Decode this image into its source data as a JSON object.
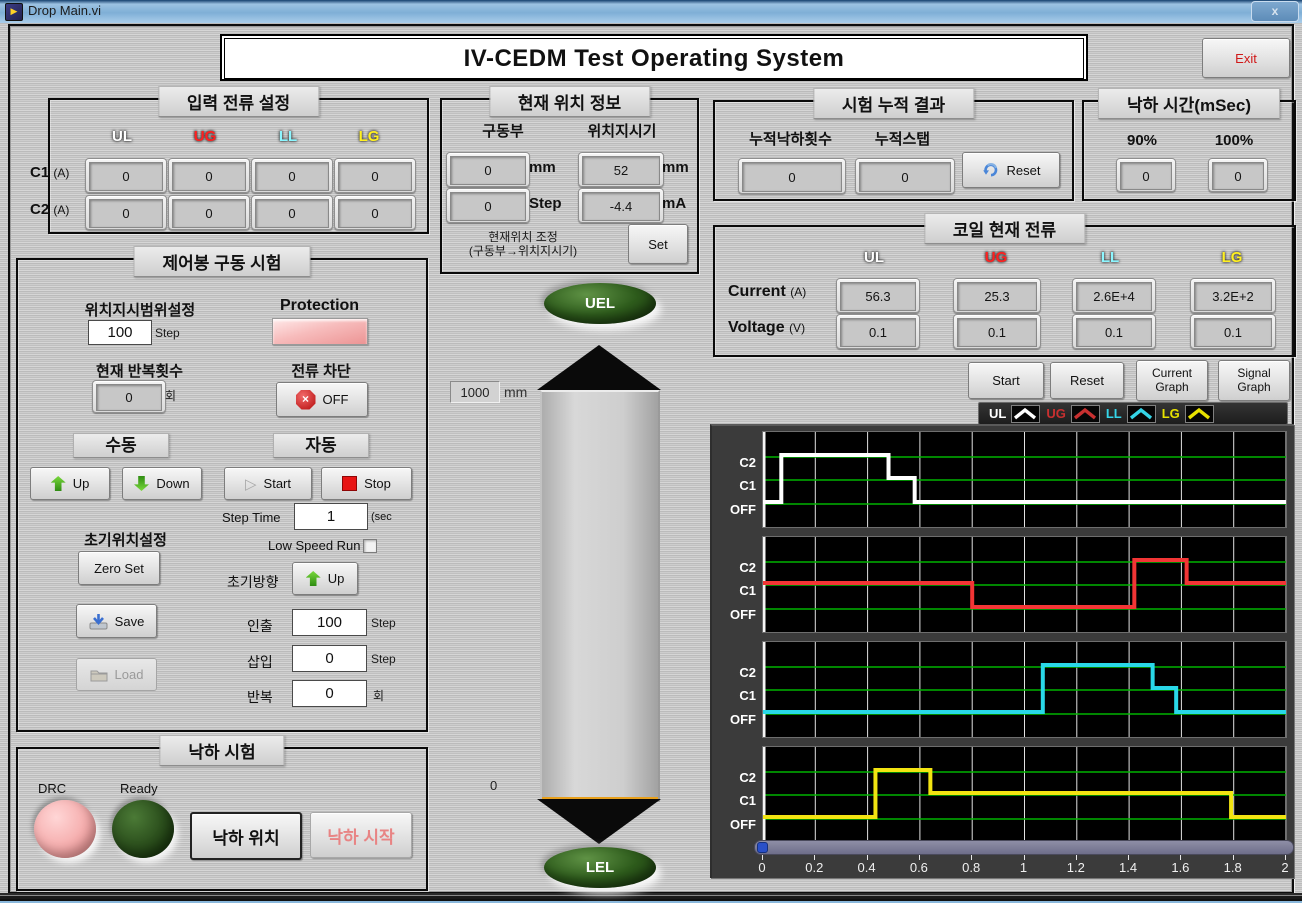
{
  "window": {
    "title": "Drop Main.vi",
    "close_label": "x"
  },
  "header": {
    "title": "IV-CEDM Test Operating System",
    "exit_label": "Exit"
  },
  "channel_colors": {
    "UL": "#ffffff",
    "UG": "#ff2020",
    "LL": "#8cf6ff",
    "LG": "#fff021"
  },
  "input_current": {
    "title": "입력 전류 설정",
    "cols": [
      "UL",
      "UG",
      "LL",
      "LG"
    ],
    "row1_label": "C1",
    "row1_unit": "(A)",
    "row2_label": "C2",
    "row2_unit": "(A)",
    "c1_values": [
      "0",
      "0",
      "0",
      "0"
    ],
    "c2_values": [
      "0",
      "0",
      "0",
      "0"
    ]
  },
  "position_info": {
    "title": "현재 위치 정보",
    "drive_label": "구동부",
    "indicator_label": "위치지시기",
    "drive_mm": "0",
    "drive_step": "0",
    "pi_mm": "52",
    "pi_ma": "-4.4",
    "unit_mm_l": "mm",
    "unit_step": "Step",
    "unit_mm_r": "mm",
    "unit_ma": "mA",
    "note1": "현재위치 조정",
    "note2": "(구동부→위치지시기)",
    "set_label": "Set"
  },
  "cumulative": {
    "title": "시험 누적 결과",
    "count_label": "누적낙하횟수",
    "count_value": "0",
    "step_label": "누적스탭",
    "step_value": "0",
    "reset_label": "Reset"
  },
  "drop_time": {
    "title": "낙하 시간(mSec)",
    "p90_label": "90%",
    "p90_value": "0",
    "p100_label": "100%",
    "p100_value": "0"
  },
  "coil": {
    "title": "코일 현재 전류",
    "cols": [
      "UL",
      "UG",
      "LL",
      "LG"
    ],
    "current_label": "Current",
    "current_unit": "(A)",
    "voltage_label": "Voltage",
    "voltage_unit": "(V)",
    "current_values": [
      "56.3",
      "25.3",
      "2.6E+4",
      "3.2E+2"
    ],
    "voltage_values": [
      "0.1",
      "0.1",
      "0.1",
      "0.1"
    ]
  },
  "rod": {
    "title": "제어봉 구동 시험",
    "range_label": "위치지시범위설정",
    "range_value": "100",
    "range_unit": "Step",
    "protection_label": "Protection",
    "repeat_label": "현재 반복횟수",
    "repeat_value": "0",
    "repeat_unit": "회",
    "cutoff_label": "전류 차단",
    "cutoff_btn": "OFF",
    "manual_label": "수동",
    "auto_label": "자동",
    "up_label": "Up",
    "down_label": "Down",
    "start_label": "Start",
    "stop_label": "Stop",
    "step_time_label": "Step Time",
    "step_time_value": "1",
    "step_time_unit": "(sec",
    "low_speed_label": "Low Speed Run",
    "init_pos_label": "초기위치설정",
    "zero_set_label": "Zero Set",
    "save_label": "Save",
    "load_label": "Load",
    "init_dir_label": "초기방향",
    "init_dir_btn": "Up",
    "withdraw_label": "인출",
    "withdraw_value": "100",
    "withdraw_unit": "Step",
    "insert_label": "삽입",
    "insert_value": "0",
    "insert_unit": "Step",
    "repeat2_label": "반복",
    "repeat2_value": "0",
    "repeat2_unit": "회"
  },
  "drop_test": {
    "title": "낙하 시험",
    "drc_label": "DRC",
    "ready_label": "Ready",
    "position_btn": "낙하 위치",
    "start_btn": "낙하 시작"
  },
  "gauge": {
    "uel": "UEL",
    "lel": "LEL",
    "max": "1000",
    "max_unit": "mm",
    "min": "0"
  },
  "graph": {
    "start_label": "Start",
    "reset_label": "Reset",
    "current_graph": [
      "Current",
      "Graph"
    ],
    "signal_graph": [
      "Signal",
      "Graph"
    ]
  },
  "chart_data": {
    "type": "line",
    "title": "Signal Graph (coil energize sequence)",
    "xlabel": "",
    "ylabel": "",
    "xmin": 0,
    "xmax": 2,
    "x_ticks": [
      "0",
      "0.2",
      "0.4",
      "0.6",
      "0.8",
      "1",
      "1.2",
      "1.4",
      "1.6",
      "1.8",
      "2"
    ],
    "y_levels": [
      "OFF",
      "C1",
      "C2"
    ],
    "grid": true,
    "legend_position": "top-right",
    "legend": [
      {
        "label": "UL",
        "color": "#ffffff"
      },
      {
        "label": "UG",
        "color": "#c83030"
      },
      {
        "label": "LL",
        "color": "#35d5e8"
      },
      {
        "label": "LG",
        "color": "#e8e200"
      }
    ],
    "series": [
      {
        "name": "UL",
        "color": "#ffffff",
        "steps": [
          [
            0,
            "OFF"
          ],
          [
            0.07,
            "C2"
          ],
          [
            0.48,
            "C1"
          ],
          [
            0.58,
            "OFF"
          ]
        ]
      },
      {
        "name": "UG",
        "color": "#f23535",
        "steps": [
          [
            0,
            "C1"
          ],
          [
            0.8,
            "OFF"
          ],
          [
            1.42,
            "C2"
          ],
          [
            1.62,
            "C1"
          ]
        ]
      },
      {
        "name": "LL",
        "color": "#29d8e8",
        "steps": [
          [
            0,
            "OFF"
          ],
          [
            1.07,
            "C2"
          ],
          [
            1.49,
            "C1"
          ],
          [
            1.58,
            "OFF"
          ]
        ]
      },
      {
        "name": "LG",
        "color": "#f2e411",
        "steps": [
          [
            0,
            "OFF"
          ],
          [
            0.43,
            "C2"
          ],
          [
            0.64,
            "C1"
          ],
          [
            1.79,
            "OFF"
          ]
        ]
      }
    ]
  }
}
